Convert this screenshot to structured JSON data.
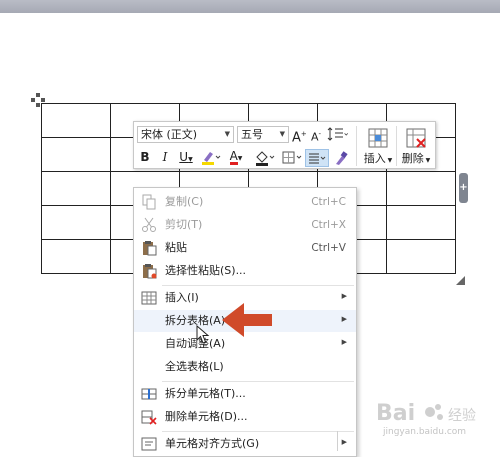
{
  "toolbar": {
    "font_name": "宋体 (正文)",
    "font_size": "五号",
    "grow_font_label": "A",
    "shrink_font_label": "A",
    "bold_label": "B",
    "italic_label": "I",
    "underline_label": "U",
    "font_color_label": "A",
    "insert_label": "插入",
    "delete_label": "删除"
  },
  "context_menu": {
    "items": [
      {
        "label": "复制(C)",
        "shortcut": "Ctrl+C",
        "disabled": true,
        "icon": "copy-icon"
      },
      {
        "label": "剪切(T)",
        "shortcut": "Ctrl+X",
        "disabled": true,
        "icon": "scissors-icon"
      },
      {
        "label": "粘贴",
        "shortcut": "Ctrl+V",
        "disabled": false,
        "icon": "paste-icon"
      },
      {
        "label": "选择性粘贴(S)...",
        "shortcut": "",
        "disabled": false,
        "icon": "paste-special-icon"
      },
      {
        "label": "插入(I)",
        "submenu": true,
        "icon": "table-insert-icon"
      },
      {
        "label": "拆分表格(A)",
        "submenu": true,
        "highlighted": true
      },
      {
        "label": "自动调整(A)",
        "submenu": true
      },
      {
        "label": "全选表格(L)"
      },
      {
        "label": "拆分单元格(T)...",
        "icon": "split-cells-icon"
      },
      {
        "label": "删除单元格(D)...",
        "icon": "delete-cells-icon"
      },
      {
        "label": "单元格对齐方式(G)",
        "submenu": true,
        "icon": "cell-align-icon"
      }
    ]
  },
  "table": {
    "rows": 5,
    "cols": 6
  },
  "watermark": {
    "text": "Bai",
    "sub_text": "jingyan.baidu.com"
  },
  "colors": {
    "arrow": "#d04a2a",
    "highlight_yellow": "#f5d800",
    "font_color_red": "#e02020",
    "disabled_text": "#9a9a9a"
  }
}
